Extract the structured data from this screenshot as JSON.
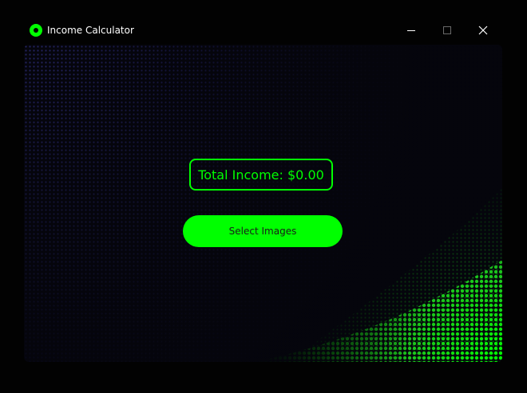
{
  "window": {
    "title": "Income Calculator",
    "app_icon": "green-ring-icon",
    "controls": {
      "minimize_icon": "minimize-icon",
      "maximize_icon": "maximize-icon",
      "close_icon": "close-icon"
    }
  },
  "main": {
    "total_income_label": "Total Income: $0.00",
    "select_button_label": "Select Images"
  },
  "colors": {
    "accent": "#00ff00",
    "background": "#020202",
    "pattern_dots": "#22225a",
    "button_text": "#1a1a1a"
  }
}
